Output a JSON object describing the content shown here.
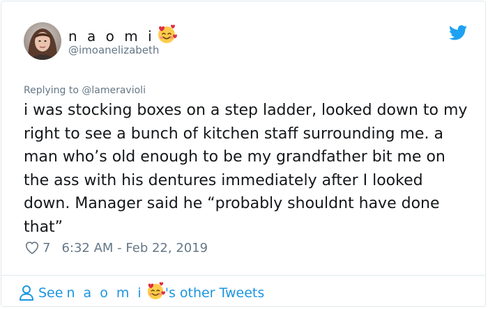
{
  "user": {
    "display_name": "n a o m i",
    "handle": "@imoanelizabeth",
    "name_emoji": "smiling-face-with-hearts-emoji",
    "avatar": "profile-photo"
  },
  "brand_icon": "twitter-bird-icon",
  "reply": {
    "text": "Replying to @lameravioli"
  },
  "tweet": {
    "text": "i was stocking boxes on a step ladder, looked down to my right to see a bunch of kitchen staff surrounding me. a man who’s old enough to be my grandfather bit me on the ass with his dentures immediately after I looked down. Manager said he “probably shouldnt have done that”"
  },
  "meta": {
    "like_icon": "heart-icon",
    "likes": "7",
    "timestamp": "6:32 AM - Feb 22, 2019"
  },
  "footer": {
    "icon": "person-icon",
    "prefix": "See",
    "name": "n a o m i",
    "suffix": "'s other Tweets"
  },
  "colors": {
    "text": "#14171a",
    "secondary": "#657786",
    "link": "#1b95e0",
    "twitter_blue": "#1da1f2",
    "border": "#e1e8ed"
  }
}
